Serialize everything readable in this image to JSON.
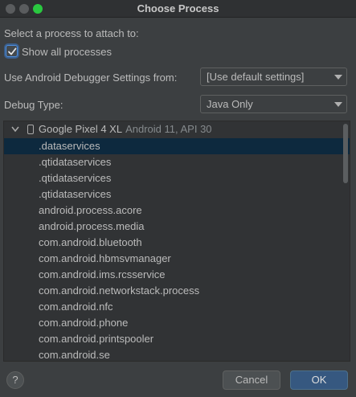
{
  "window": {
    "title": "Choose Process"
  },
  "prompt": "Select a process to attach to:",
  "show_all": {
    "label": "Show all processes",
    "checked": true
  },
  "debugger_settings": {
    "label": "Use Android Debugger Settings from:",
    "value": "[Use default settings]"
  },
  "debug_type": {
    "label": "Debug Type:",
    "value": "Java Only"
  },
  "device": {
    "name": "Google Pixel 4 XL",
    "api": "Android 11, API 30"
  },
  "processes": [
    ".dataservices",
    ".qtidataservices",
    ".qtidataservices",
    ".qtidataservices",
    "android.process.acore",
    "android.process.media",
    "com.android.bluetooth",
    "com.android.hbmsvmanager",
    "com.android.ims.rcsservice",
    "com.android.networkstack.process",
    "com.android.nfc",
    "com.android.phone",
    "com.android.printspooler",
    "com.android.se"
  ],
  "selected_index": 0,
  "buttons": {
    "help": "?",
    "cancel": "Cancel",
    "ok": "OK"
  },
  "colors": {
    "accent": "#365880",
    "selection": "#0d293e",
    "background": "#3c3f41"
  }
}
